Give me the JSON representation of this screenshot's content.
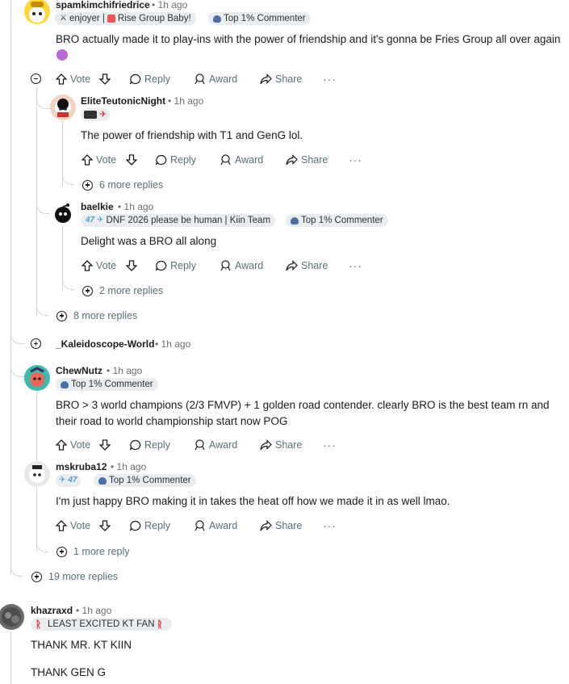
{
  "actions": {
    "vote": "Vote",
    "reply": "Reply",
    "award": "Award",
    "share": "Share",
    "more": "···"
  },
  "comments": [
    {
      "username": "spamkimchifriedrice",
      "time": "1h ago",
      "flair1": "enjoyer | ",
      "flair1b": "Rise Group Baby!",
      "flair2": "Top 1% Commenter",
      "body": "BRO actually made it to play-ins with the power of friendship and it's gonna be Fries Group all over again"
    },
    {
      "username": "EliteTeutonicNight",
      "time": "1h ago",
      "body": "The power of friendship with T1 and GenG lol.",
      "more": "6 more replies"
    },
    {
      "username": "baelkie",
      "time": "1h ago",
      "flair1": "DNF 2026 please be human | Kiin Team",
      "flair2": "Top 1% Commenter",
      "body": "Delight was a BRO all along",
      "more": "2 more replies"
    },
    {
      "more_outer": "8 more replies"
    },
    {
      "username": "_Kaleidoscope-World",
      "time": "1h ago"
    },
    {
      "username": "ChewNutz",
      "time": "1h ago",
      "flair2": "Top 1% Commenter",
      "body_line1": "BRO > 3 world champions (2/3 FMVP) + 1 golden road contender. clearly BRO is the best team rn and",
      "body_line2": "their road to world championship start now POG"
    },
    {
      "username": "mskruba12",
      "time": "1h ago",
      "flair2": "Top 1% Commenter",
      "body": "I'm just happy BRO making it in takes the heat off how we made it in as well lmao.",
      "more": "1 more reply"
    },
    {
      "more_outer": "19 more replies"
    },
    {
      "username": "khazraxd",
      "time": "1h ago",
      "flair1": "LEAST EXCITED KT FAN",
      "body_line1": "THANK MR. KT KIIN",
      "body_line2": "THANK GEN G"
    }
  ],
  "colors": {
    "text": "#1a1a1b",
    "meta": "#576f76",
    "flair_bg": "#eaedef",
    "thread": "#d4d6d8",
    "accent_red": "#e0262d"
  }
}
